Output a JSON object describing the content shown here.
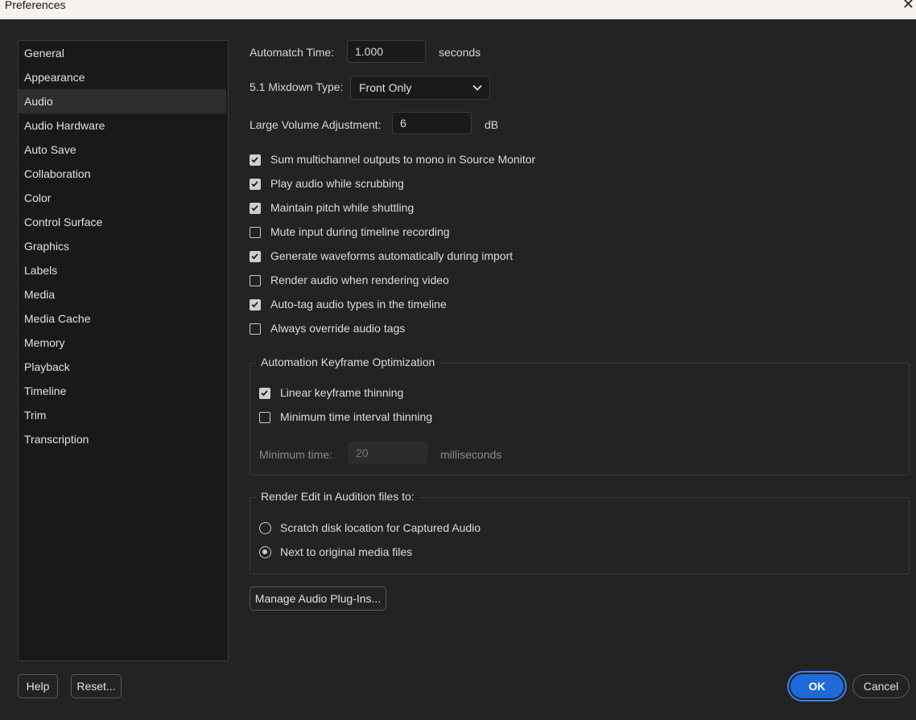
{
  "window": {
    "title": "Preferences",
    "close_glyph": "✕"
  },
  "sidebar": {
    "selected": "Audio",
    "items": [
      {
        "label": "General"
      },
      {
        "label": "Appearance"
      },
      {
        "label": "Audio"
      },
      {
        "label": "Audio Hardware"
      },
      {
        "label": "Auto Save"
      },
      {
        "label": "Collaboration"
      },
      {
        "label": "Color"
      },
      {
        "label": "Control Surface"
      },
      {
        "label": "Graphics"
      },
      {
        "label": "Labels"
      },
      {
        "label": "Media"
      },
      {
        "label": "Media Cache"
      },
      {
        "label": "Memory"
      },
      {
        "label": "Playback"
      },
      {
        "label": "Timeline"
      },
      {
        "label": "Trim"
      },
      {
        "label": "Transcription"
      }
    ]
  },
  "audio": {
    "automatch_label": "Automatch Time:",
    "automatch_value": "1.000",
    "automatch_unit": "seconds",
    "mixdown_label": "5.1 Mixdown Type:",
    "mixdown_value": "Front Only",
    "large_volume_label": "Large Volume Adjustment:",
    "large_volume_value": "6",
    "large_volume_unit": "dB",
    "checkboxes": [
      {
        "label": "Sum multichannel outputs to mono in Source Monitor",
        "checked": true
      },
      {
        "label": "Play audio while scrubbing",
        "checked": true
      },
      {
        "label": "Maintain pitch while shuttling",
        "checked": true
      },
      {
        "label": "Mute input during timeline recording",
        "checked": false
      },
      {
        "label": "Generate waveforms automatically during import",
        "checked": true
      },
      {
        "label": "Render audio when rendering video",
        "checked": false
      },
      {
        "label": "Auto-tag audio types in the timeline",
        "checked": true
      },
      {
        "label": "Always override audio tags",
        "checked": false
      }
    ],
    "keyframe_group": {
      "title": "Automation Keyframe Optimization",
      "checkboxes": [
        {
          "label": "Linear keyframe thinning",
          "checked": true
        },
        {
          "label": "Minimum time interval thinning",
          "checked": false
        }
      ],
      "min_time_label": "Minimum time:",
      "min_time_value": "20",
      "min_time_unit": "milliseconds"
    },
    "render_group": {
      "title": "Render Edit in Audition files to:",
      "options": [
        {
          "label": "Scratch disk location for Captured Audio",
          "selected": false
        },
        {
          "label": "Next to original media files",
          "selected": true
        }
      ]
    },
    "manage_plugins_label": "Manage Audio Plug-Ins..."
  },
  "footer": {
    "help_label": "Help",
    "reset_label": "Reset...",
    "ok_label": "OK",
    "cancel_label": "Cancel"
  },
  "colors": {
    "accent": "#1e6ad8",
    "background": "#232323",
    "sidebar_bg": "#191919"
  }
}
